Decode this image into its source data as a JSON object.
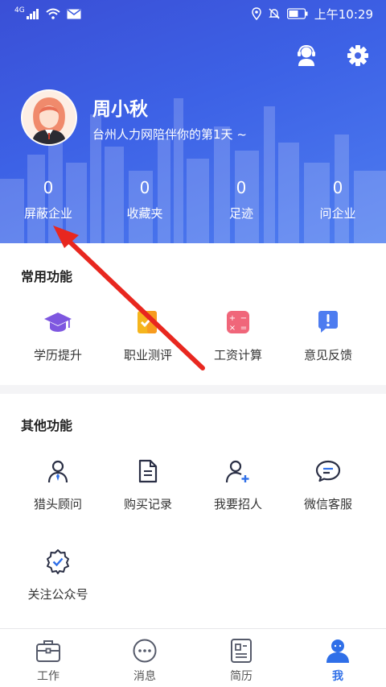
{
  "status_bar": {
    "network": "4G",
    "time": "上午10:29"
  },
  "profile": {
    "name": "周小秋",
    "slogan": "台州人力网陪伴你的第1天 ~"
  },
  "stats": [
    {
      "value": "0",
      "label": "屏蔽企业"
    },
    {
      "value": "0",
      "label": "收藏夹"
    },
    {
      "value": "0",
      "label": "足迹"
    },
    {
      "value": "0",
      "label": "问企业"
    }
  ],
  "common_functions": {
    "title": "常用功能",
    "items": [
      {
        "label": "学历提升",
        "icon": "graduation-cap-icon"
      },
      {
        "label": "职业测评",
        "icon": "assessment-icon"
      },
      {
        "label": "工资计算",
        "icon": "calculator-icon"
      },
      {
        "label": "意见反馈",
        "icon": "feedback-icon"
      }
    ]
  },
  "other_functions": {
    "title": "其他功能",
    "items": [
      {
        "label": "猎头顾问",
        "icon": "headhunter-icon"
      },
      {
        "label": "购买记录",
        "icon": "document-icon"
      },
      {
        "label": "我要招人",
        "icon": "add-person-icon"
      },
      {
        "label": "微信客服",
        "icon": "chat-bubble-icon"
      },
      {
        "label": "关注公众号",
        "icon": "verified-badge-icon"
      }
    ]
  },
  "tabbar": [
    {
      "label": "工作",
      "icon": "briefcase-icon",
      "active": false
    },
    {
      "label": "消息",
      "icon": "message-icon",
      "active": false
    },
    {
      "label": "简历",
      "icon": "resume-icon",
      "active": false
    },
    {
      "label": "我",
      "icon": "me-icon",
      "active": true
    }
  ],
  "colors": {
    "header_start": "#3a4fd6",
    "header_end": "#4e7df0",
    "accent": "#2f6fe8",
    "annotation_arrow": "#e8271f"
  }
}
